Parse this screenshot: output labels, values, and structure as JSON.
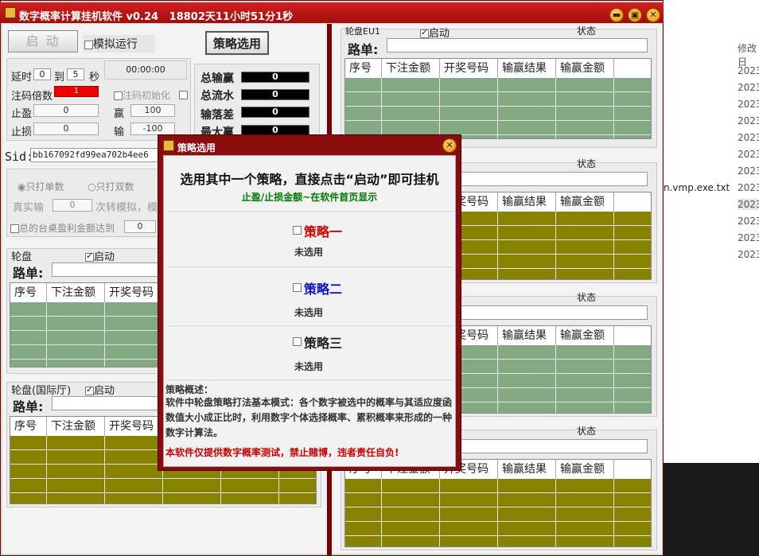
{
  "window": {
    "title": "数字概率计算挂机软件 v0.24",
    "uptime": "18802天11小时51分1秒",
    "controls": {
      "minimize": "▬",
      "maximize": "▣",
      "close": "✕"
    }
  },
  "toolbar": {
    "start_label": "启 动",
    "simulate_label": "模拟运行",
    "strategy_label": "策略选用"
  },
  "settings": {
    "delay_label": "延时",
    "delay_from": "0",
    "to_label": "到",
    "delay_to": "5",
    "sec_label": "秒",
    "timer": "00:00:00",
    "multiplier_label": "注码倍数",
    "multiplier_value": "1",
    "init_label": "注码初始化",
    "take_profit_label": "止盈",
    "take_profit_value": "0",
    "stop_loss_label": "止损",
    "stop_loss_value": "0",
    "win_label": "赢",
    "win_value": "100",
    "lose_label": "输",
    "lose_value": "-100"
  },
  "stats": {
    "total_win_label": "总输赢",
    "total_win": "0",
    "total_flow_label": "总流水",
    "total_flow": "0",
    "diff_label": "输落差",
    "diff": "0",
    "max_win_label": "最大赢",
    "max_win": "0"
  },
  "sid": {
    "label": "Sid:",
    "value": "bb167092fd99ea702b4ee6"
  },
  "mode": {
    "single_label": "只打单数",
    "double_label": "只打双数",
    "real_lose_label": "真实输",
    "real_lose_value": "0",
    "sim_text": "次转模拟，模",
    "table_total_label": "总的台桌盈利金额达到",
    "table_total_value": "0"
  },
  "roulette_panels": {
    "left_top_title": "轮盘",
    "left_bottom_title": "轮盘(国际厅)",
    "right1_title": "轮盘EU1",
    "enable_label": "启动",
    "status_label": "状态",
    "route_label": "路单:",
    "columns": [
      "序号",
      "下注金额",
      "开奖号码",
      "输赢结果",
      "输赢金额"
    ]
  },
  "dialog": {
    "title": "策略选用",
    "headline": "选用其中一个策略，直接点击“启动”即可挂机",
    "subline": "止盈/止损金额~在软件首页显示",
    "strategies": [
      {
        "name": "策略一",
        "status": "未选用",
        "color": "#cc0000"
      },
      {
        "name": "策略二",
        "status": "未选用",
        "color": "#1010cc"
      },
      {
        "name": "策略三",
        "status": "未选用",
        "color": "#222222"
      }
    ],
    "desc_title": "策略概述：",
    "desc_text": "软件中轮盘策略打法基本模式：各个数字被选中的概率与其适应度函数值大小成正比时，利用数字个体选择概率、累积概率来形成的一种数字计算法。",
    "warning": "本软件仅提供数字概率测试，禁止赌博，违者责任自负!"
  },
  "background": {
    "column_header": "修改日",
    "dates": [
      "2023",
      "2023",
      "2023",
      "2023",
      "2023",
      "2023",
      "2023",
      "2023",
      "2023",
      "2023",
      "2023",
      "2023"
    ],
    "file_fragment": "n.vmp.exe.txt"
  }
}
